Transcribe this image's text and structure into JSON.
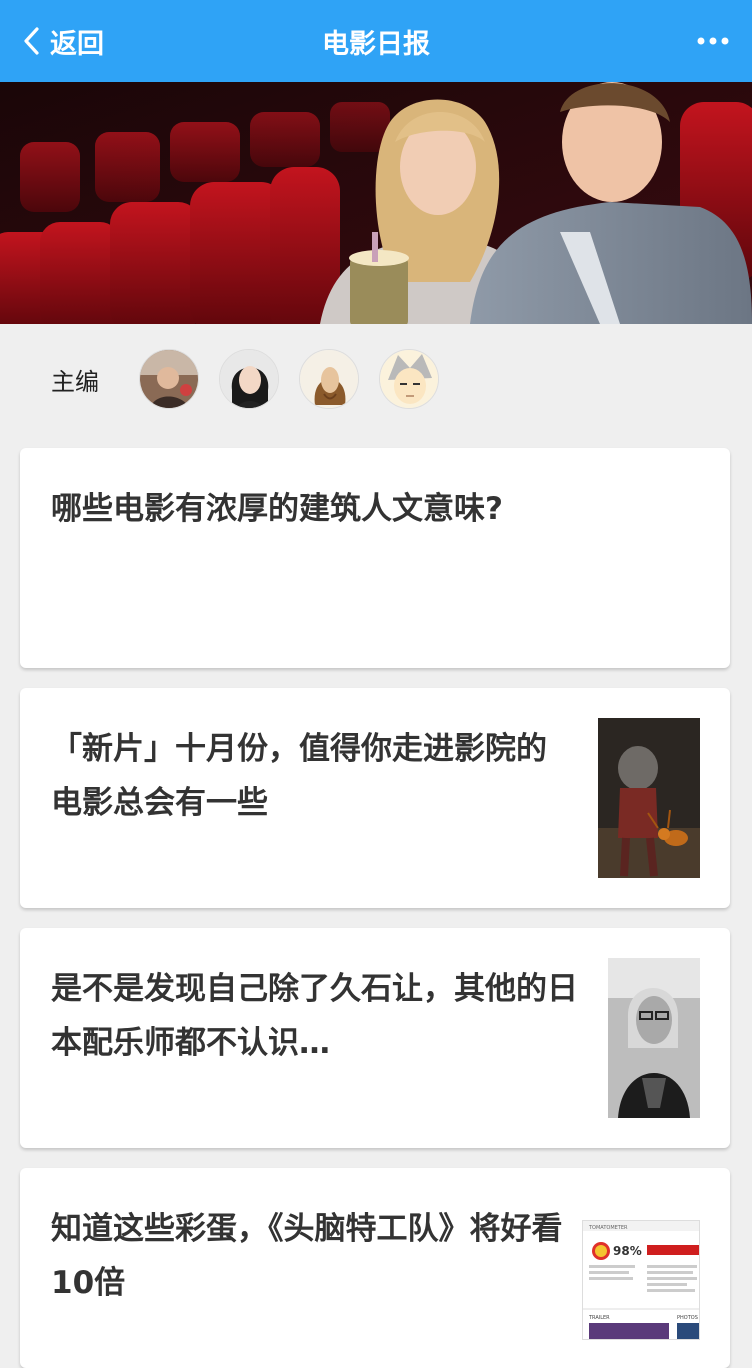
{
  "nav": {
    "back_label": "返回",
    "title": "电影日报",
    "accent_color": "#2fa3f6"
  },
  "editors": {
    "label": "主编",
    "avatars": [
      "editor-avatar-1",
      "editor-avatar-2",
      "editor-avatar-3",
      "editor-avatar-4"
    ]
  },
  "articles": [
    {
      "title": "哪些电影有浓厚的建筑人文意味?"
    },
    {
      "title": "「新片」十月份，值得你走进影院的电影总会有一些"
    },
    {
      "title": "是不是发现自己除了久石让，其他的日本配乐师都不认识…"
    },
    {
      "title": "知道这些彩蛋，《头脑特工队》将好看10倍",
      "thumb_text": {
        "brand": "TOMATOMETER",
        "score": "98%",
        "tab": "TRAILER",
        "tab2": "PHOTOS"
      }
    }
  ]
}
